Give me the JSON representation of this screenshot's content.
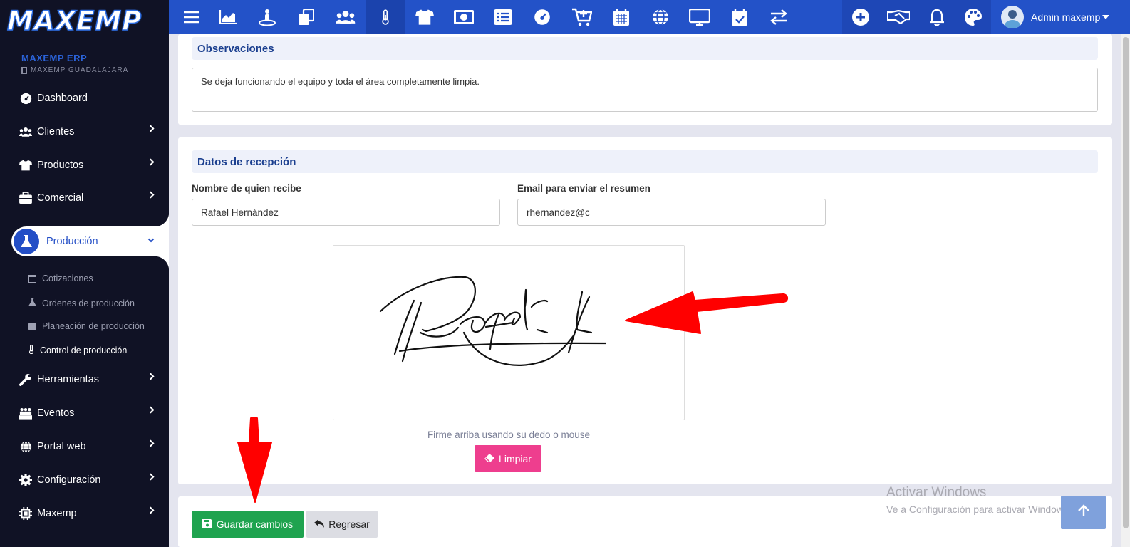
{
  "brand": {
    "logo": "MAXEMP",
    "org_name": "MAXEMP ERP",
    "branch": "MAXEMP GUADALAJARA"
  },
  "sidebar": {
    "items": [
      {
        "label": "Dashboard",
        "icon": "dashboard-icon"
      },
      {
        "label": "Clientes",
        "icon": "users-icon"
      },
      {
        "label": "Productos",
        "icon": "shirt-icon"
      },
      {
        "label": "Comercial",
        "icon": "briefcase-icon"
      },
      {
        "label": "Producción",
        "icon": "flask-icon",
        "active": true
      },
      {
        "label": "Herramientas",
        "icon": "wrench-icon"
      },
      {
        "label": "Eventos",
        "icon": "people-event-icon"
      },
      {
        "label": "Portal web",
        "icon": "globe-icon"
      },
      {
        "label": "Configuración",
        "icon": "gear-icon"
      },
      {
        "label": "Maxemp",
        "icon": "chip-icon"
      }
    ],
    "sub_items": [
      {
        "label": "Cotizaciones",
        "icon": "table-icon"
      },
      {
        "label": "Ordenes de producción",
        "icon": "flask-small-icon"
      },
      {
        "label": "Planeación de producción",
        "icon": "check-square-icon"
      },
      {
        "label": "Control de producción",
        "icon": "thermometer-icon",
        "current": true
      }
    ]
  },
  "topbar": {
    "icons": [
      "menu-icon",
      "chart-area-icon",
      "person-pin-icon",
      "copy-icon",
      "users-icon",
      "thermometer-icon",
      "shirt-icon",
      "money-icon",
      "list-icon",
      "gauge-icon",
      "cart-plus-icon",
      "calendar-icon",
      "globe-icon",
      "desktop-icon",
      "calendar-check-icon",
      "exchange-icon"
    ],
    "selected_icon": "thermometer-icon",
    "right_icons": [
      "plus-circle-icon",
      "handshake-icon",
      "bell-icon",
      "palette-icon"
    ],
    "user_name": "Admin maxemp"
  },
  "observaciones": {
    "title": "Observaciones",
    "text": "Se deja funcionando el equipo y toda el área completamente limpia."
  },
  "recepcion": {
    "title": "Datos de recepción",
    "name_label": "Nombre de quien recibe",
    "name_value": "Rafael Hernández",
    "email_label": "Email para enviar el resumen",
    "email_value": "rhernandez@c",
    "signature_hint": "Firme arriba usando su dedo o mouse",
    "clear_label": "Limpiar"
  },
  "actions": {
    "save_label": "Guardar cambios",
    "back_label": "Regresar"
  },
  "watermark": {
    "line1": "Activar Windows",
    "line2": "Ve a Configuración para activar Windows."
  },
  "colors": {
    "topbar": "#2352c8",
    "sidebar": "#101225",
    "accent": "#234ec6",
    "save": "#1fa34f",
    "clear": "#ee3e8e",
    "annotation_arrow": "#ff0000"
  }
}
